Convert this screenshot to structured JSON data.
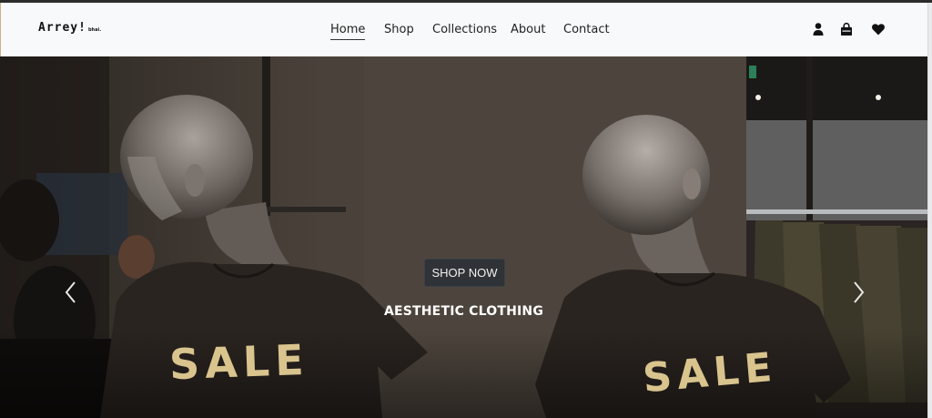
{
  "brand": {
    "name": "Arrey!",
    "suffix": "bhai."
  },
  "nav": {
    "links": [
      {
        "label": "Home",
        "active": true
      },
      {
        "label": "Shop",
        "active": false
      },
      {
        "label": "Collections",
        "active": false
      },
      {
        "label": "About",
        "active": false
      },
      {
        "label": "Contact",
        "active": false
      }
    ],
    "icons": [
      "user-icon",
      "shopping-bag-icon",
      "heart-icon"
    ]
  },
  "hero": {
    "button_label": "SHOP NOW",
    "caption": "AESTHETIC CLOTHING",
    "shirt_text_left": "SALE",
    "shirt_text_right": "SALE",
    "controls": [
      "chevron-left-icon",
      "chevron-right-icon"
    ]
  },
  "colors": {
    "navbar_bg": "#f8f9fa",
    "button_bg": "#2f3237",
    "sale_text": "#d9c48e",
    "shirt": "#2a2420"
  }
}
